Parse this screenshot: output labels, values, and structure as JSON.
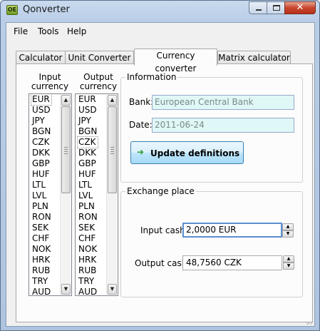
{
  "window": {
    "title": "Qonverter",
    "icon": "qonverter-app-icon",
    "icon_text": "OE"
  },
  "menu": [
    "File",
    "Tools",
    "Help"
  ],
  "tabs": [
    {
      "label": "Calculator",
      "active": false
    },
    {
      "label": "Unit Converter",
      "active": false
    },
    {
      "label": "Currency converter",
      "active": true
    },
    {
      "label": "Matrix calculator",
      "active": false
    }
  ],
  "input_currency": {
    "label_line1": "Input",
    "label_line2": "currency",
    "selected": "EUR",
    "items": [
      "EUR",
      "USD",
      "JPY",
      "BGN",
      "CZK",
      "DKK",
      "GBP",
      "HUF",
      "LTL",
      "LVL",
      "PLN",
      "RON",
      "SEK",
      "CHF",
      "NOK",
      "HRK",
      "RUB",
      "TRY",
      "AUD"
    ]
  },
  "output_currency": {
    "label_line1": "Output",
    "label_line2": "currency",
    "selected": "CZK",
    "items": [
      "EUR",
      "USD",
      "JPY",
      "BGN",
      "CZK",
      "DKK",
      "GBP",
      "HUF",
      "LTL",
      "LVL",
      "PLN",
      "RON",
      "SEK",
      "CHF",
      "NOK",
      "HRK",
      "RUB",
      "TRY",
      "AUD"
    ]
  },
  "information": {
    "title": "Information",
    "bank_label": "Bank:",
    "bank_value": "European Central Bank",
    "date_label": "Date:",
    "date_value": "2011-06-24",
    "update_button": "Update definitions",
    "update_icon": "green-arrow-icon"
  },
  "exchange": {
    "title": "Exchange place",
    "input_label": "Input cash:",
    "input_value": "2,0000 EUR",
    "output_label": "Output cash:",
    "output_value": "48,7560 CZK"
  },
  "colors": {
    "readonly_field_bg": "#dff7f7",
    "focus_border": "#5a8fcf",
    "close_button": "#c6452c"
  }
}
